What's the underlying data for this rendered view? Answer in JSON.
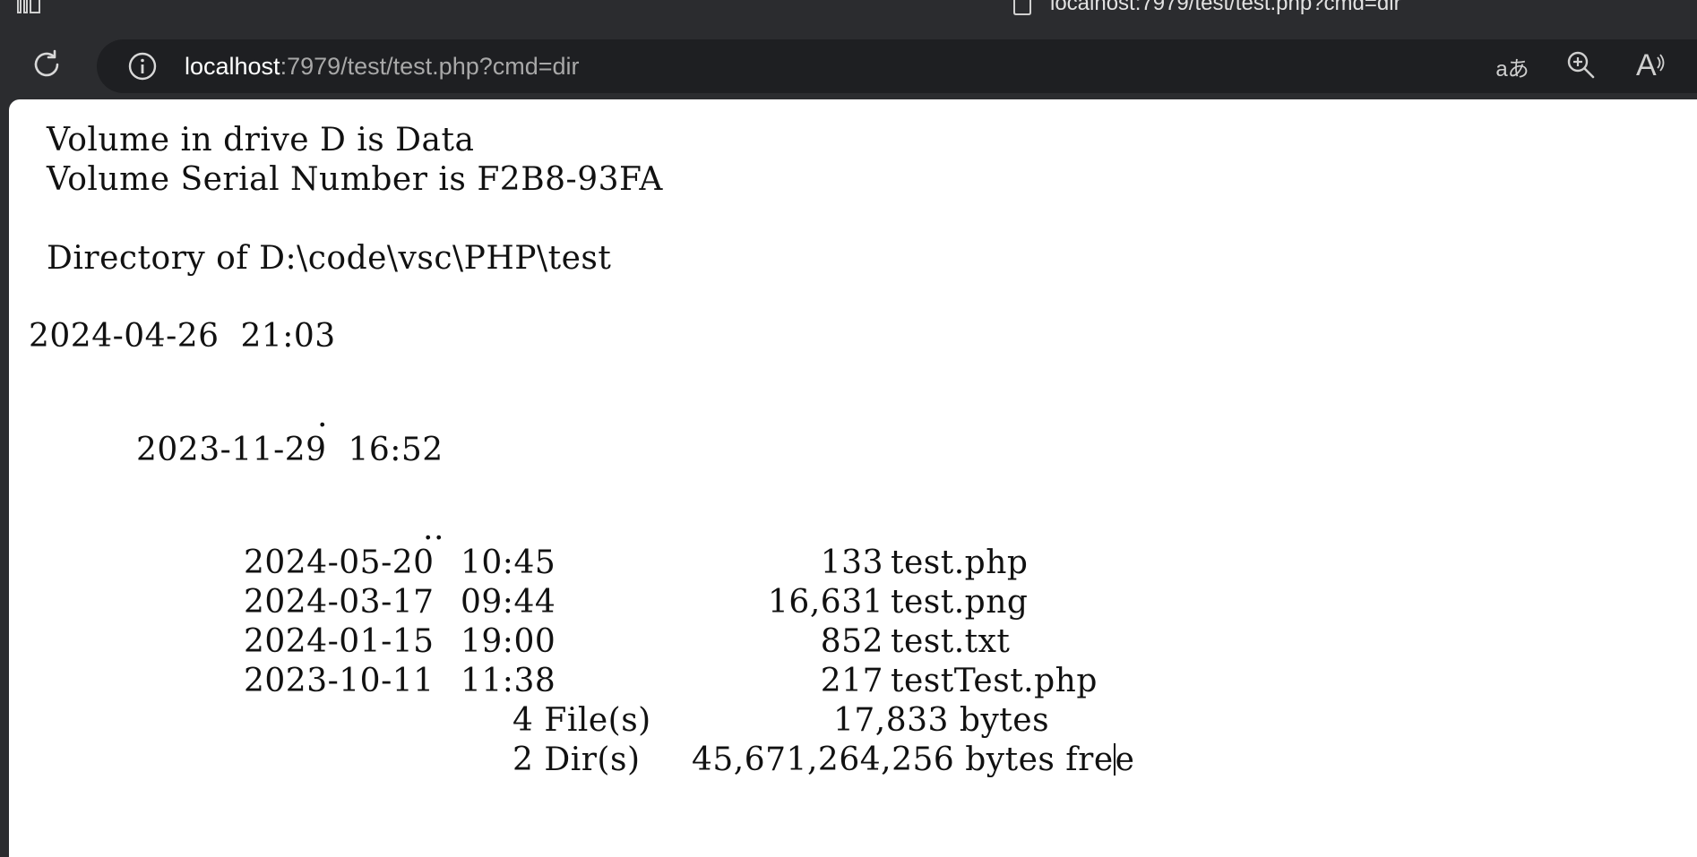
{
  "browser": {
    "tab_title": "localhost:7979/test/test.php?cmd=dir",
    "url_host": "localhost",
    "url_rest": ":7979/test/test.php?cmd=dir",
    "read_aloud_label": "A",
    "translate_label": "aあ"
  },
  "output": {
    "volume_line": "Volume in drive D is Data",
    "serial_line": "Volume Serial Number is F2B8-93FA",
    "directory_line": "Directory of D:\\code\\vsc\\PHP\\test",
    "entry_dot_date": "2024-04-26  21:03",
    "entry_dot_name": ".",
    "entry_dotdot_date": "2023-11-29  16:52",
    "entry_dotdot_name": "..",
    "files": [
      {
        "date": "2024-05-20",
        "time": "10:45",
        "size": "133",
        "name": "test.php"
      },
      {
        "date": "2024-03-17",
        "time": "09:44",
        "size": "16,631",
        "name": "test.png"
      },
      {
        "date": "2024-01-15",
        "time": "19:00",
        "size": "852",
        "name": "test.txt"
      },
      {
        "date": "2023-10-11",
        "time": "11:38",
        "size": "217",
        "name": "testTest.php"
      }
    ],
    "summary_files_count": "4 File(s)",
    "summary_files_bytes": "17,833 bytes",
    "summary_dirs_count": "2 Dir(s)",
    "summary_dirs_bytes": "45,671,264,256 bytes fre",
    "summary_dirs_tail": "e"
  }
}
